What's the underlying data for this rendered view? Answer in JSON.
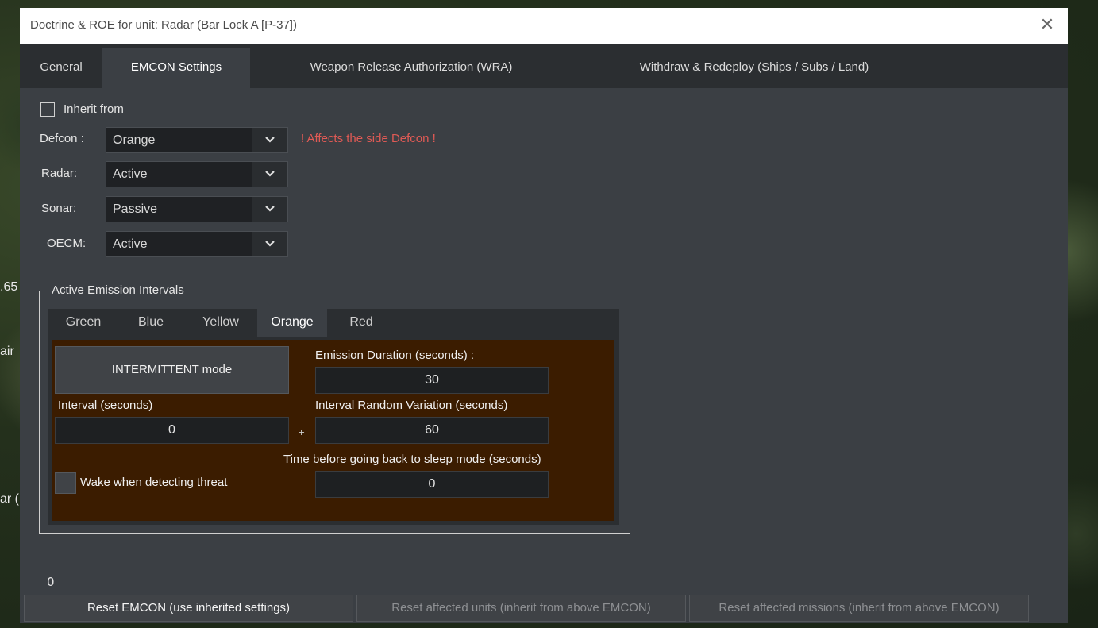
{
  "background": {
    "text1": ".65",
    "text2": "air",
    "text3": "ar ("
  },
  "window": {
    "title": "Doctrine & ROE for unit: Radar (Bar Lock A [P-37])",
    "close_symbol": "✕"
  },
  "tabs": [
    {
      "label": "General"
    },
    {
      "label": "EMCON Settings"
    },
    {
      "label": "Weapon Release Authorization (WRA)"
    },
    {
      "label": "Withdraw & Redeploy (Ships / Subs / Land)"
    }
  ],
  "emcon": {
    "inherit_label": "Inherit from",
    "defcon": {
      "label": "Defcon :",
      "value": "Orange",
      "warning": "! Affects the side Defcon !"
    },
    "radar": {
      "label": "Radar:",
      "value": "Active"
    },
    "sonar": {
      "label": "Sonar:",
      "value": "Passive"
    },
    "oecm": {
      "label": "OECM:",
      "value": "Active"
    }
  },
  "intervals": {
    "group_title": "Active Emission Intervals",
    "tabs": [
      {
        "label": "Green"
      },
      {
        "label": "Blue"
      },
      {
        "label": "Yellow"
      },
      {
        "label": "Orange"
      },
      {
        "label": "Red"
      }
    ],
    "mode_button": "INTERMITTENT mode",
    "emission_duration_label": "Emission Duration (seconds) :",
    "emission_duration": "30",
    "interval_label": "Interval (seconds)",
    "interval": "0",
    "plus": "+",
    "variation_label": "Interval Random Variation (seconds)",
    "variation": "60",
    "sleep_label": "Time before going back to sleep mode (seconds)",
    "sleep": "0",
    "wake_label": "Wake when detecting threat"
  },
  "footer": {
    "counter": "0",
    "reset_emcon": "Reset EMCON (use inherited settings)",
    "reset_units": "Reset affected units (inherit from above EMCON)",
    "reset_missions": "Reset affected missions (inherit from above EMCON)"
  },
  "colors": {
    "warning": "#e05a55",
    "content_bg": "#3b1c00",
    "panel_bg": "#3b3f44"
  }
}
